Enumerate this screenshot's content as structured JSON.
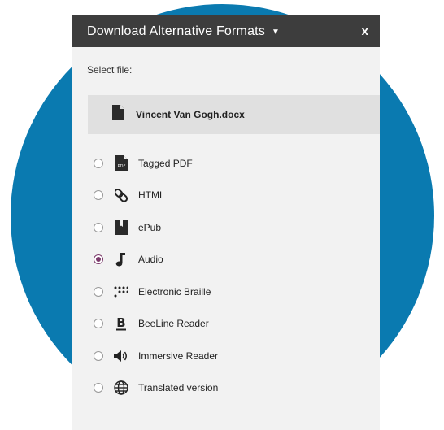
{
  "header": {
    "title": "Download Alternative Formats",
    "close_label": "x"
  },
  "select_label": "Select file:",
  "file": {
    "name": "Vincent Van Gogh.docx",
    "icon": "document-icon"
  },
  "options": [
    {
      "label": "Tagged PDF",
      "icon": "pdf-icon",
      "checked": false
    },
    {
      "label": "HTML",
      "icon": "link-icon",
      "checked": false
    },
    {
      "label": "ePub",
      "icon": "book-icon",
      "checked": false
    },
    {
      "label": "Audio",
      "icon": "music-note-icon",
      "checked": true
    },
    {
      "label": "Electronic Braille",
      "icon": "braille-icon",
      "checked": false
    },
    {
      "label": "BeeLine Reader",
      "icon": "beeline-icon",
      "checked": false
    },
    {
      "label": "Immersive Reader",
      "icon": "speaker-icon",
      "checked": false
    },
    {
      "label": "Translated version",
      "icon": "globe-icon",
      "checked": false
    }
  ],
  "colors": {
    "background_circle": "#0a7ab0",
    "header": "#3d3d3d",
    "panel": "#f2f2f2",
    "radio_selected": "#7b3a6b"
  }
}
